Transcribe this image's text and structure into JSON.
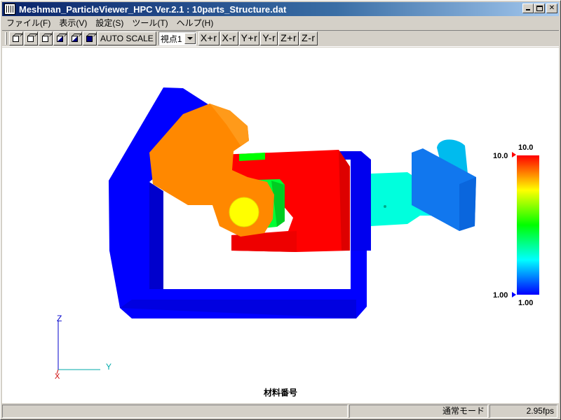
{
  "window": {
    "title": "Meshman_ParticleViewer_HPC Ver.2.1 : 10parts_Structure.dat",
    "icon": "app-grid-icon"
  },
  "menu": {
    "items": [
      "ファイル(F)",
      "表示(V)",
      "設定(S)",
      "ツール(T)",
      "ヘルプ(H)"
    ]
  },
  "toolbar": {
    "auto_scale": "AUTO SCALE",
    "view_select": "視点1",
    "axis_buttons": [
      "X+r",
      "X-r",
      "Y+r",
      "Y-r",
      "Z+r",
      "Z-r"
    ]
  },
  "legend": {
    "max_label": "10.0",
    "max_value": "10.0",
    "min_value": "1.00",
    "min_label": "1.00",
    "gradient": [
      "#ff0000",
      "#ffff00",
      "#00ff00",
      "#00ffff",
      "#0000ff"
    ]
  },
  "axes": {
    "z": "Z",
    "y": "Y",
    "x": "X"
  },
  "caption": "材料番号",
  "status": {
    "mode": "通常モード",
    "fps": "2.95fps"
  }
}
